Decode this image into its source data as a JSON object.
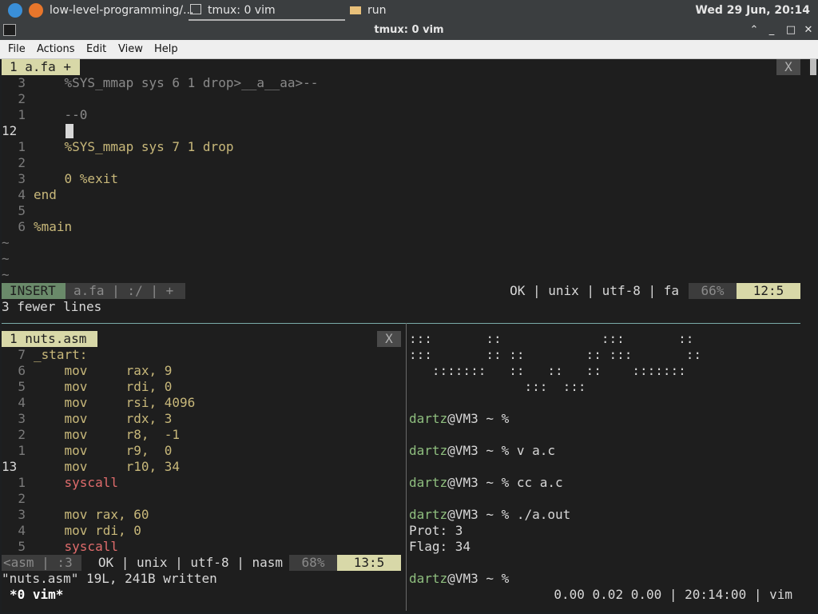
{
  "topbar": {
    "apps_icon": "app-menu-icon",
    "firefox_icon": "firefox-icon",
    "task1": "low-level-programming/...",
    "task2": "tmux: 0 vim",
    "task3": "run",
    "clock": "Wed 29 Jun, 20:14"
  },
  "window": {
    "title": "tmux: 0 vim",
    "terminal_icon": "terminal-icon"
  },
  "menu": [
    "File",
    "Actions",
    "Edit",
    "View",
    "Help"
  ],
  "top_pane": {
    "tab_label": "1 a.fa +",
    "tab_close": "X",
    "lines": [
      {
        "num": "3",
        "text": "    %SYS_mmap sys 6 1 drop>__a__aa>--"
      },
      {
        "num": "2",
        "text": ""
      },
      {
        "num": "1",
        "text": "    --0"
      },
      {
        "num": "12",
        "text": ""
      },
      {
        "num": "1",
        "text": "    %SYS_mmap sys 7 1 drop"
      },
      {
        "num": "2",
        "text": ""
      },
      {
        "num": "3",
        "text": "    0 %exit"
      },
      {
        "num": "4",
        "text": "end"
      },
      {
        "num": "5",
        "text": ""
      },
      {
        "num": "6",
        "text": "%main"
      }
    ],
    "tildes": [
      "~",
      "~",
      "~"
    ],
    "status": {
      "mode": "INSERT",
      "file": "a.fa | :/ | +",
      "info": "OK | unix | utf-8 | fa",
      "percent": "66%",
      "pos": "12:5"
    },
    "message": "3 fewer lines"
  },
  "bottom_left": {
    "tab_label": "1 nuts.asm",
    "tab_close": "X",
    "lines": [
      {
        "num": "7",
        "text": "_start:"
      },
      {
        "num": "6",
        "text": "    mov     rax, 9"
      },
      {
        "num": "5",
        "text": "    mov     rdi, 0"
      },
      {
        "num": "4",
        "text": "    mov     rsi, 4096"
      },
      {
        "num": "3",
        "text": "    mov     rdx, 3"
      },
      {
        "num": "2",
        "text": "    mov     r8,  -1"
      },
      {
        "num": "1",
        "text": "    mov     r9,  0"
      },
      {
        "num": "13",
        "text": "    mov     r10, 34"
      },
      {
        "num": "1",
        "text": "    syscall"
      },
      {
        "num": "2",
        "text": ""
      },
      {
        "num": "3",
        "text": "    mov rax, 60"
      },
      {
        "num": "4",
        "text": "    mov rdi, 0"
      },
      {
        "num": "5",
        "text": "    syscall"
      }
    ],
    "status": {
      "file": "<asm | :3",
      "info": "OK | unix | utf-8 | nasm",
      "percent": "68%",
      "pos": "13:5"
    },
    "message": "\"nuts.asm\" 19L, 241B written"
  },
  "bottom_right": {
    "art": [
      ":::       ::             :::       ::",
      ":::       :: ::        :: :::       ::",
      "   :::::::   ::   ::   ::    :::::::",
      "               :::  :::"
    ],
    "prompt_user": "dartz",
    "prompt_host": "@VM3 ~ %",
    "commands": [
      {
        "cmd": "",
        "output": []
      },
      {
        "cmd": " v a.c",
        "output": []
      },
      {
        "cmd": " cc a.c",
        "output": []
      },
      {
        "cmd": " ./a.out",
        "output": [
          "Prot: 3",
          "Flag: 34"
        ]
      },
      {
        "cmd": "",
        "output": []
      }
    ]
  },
  "tmux_status": {
    "window": "*0 vim*",
    "right": "0.00 0.02 0.00 | 20:14:00 | vim"
  }
}
